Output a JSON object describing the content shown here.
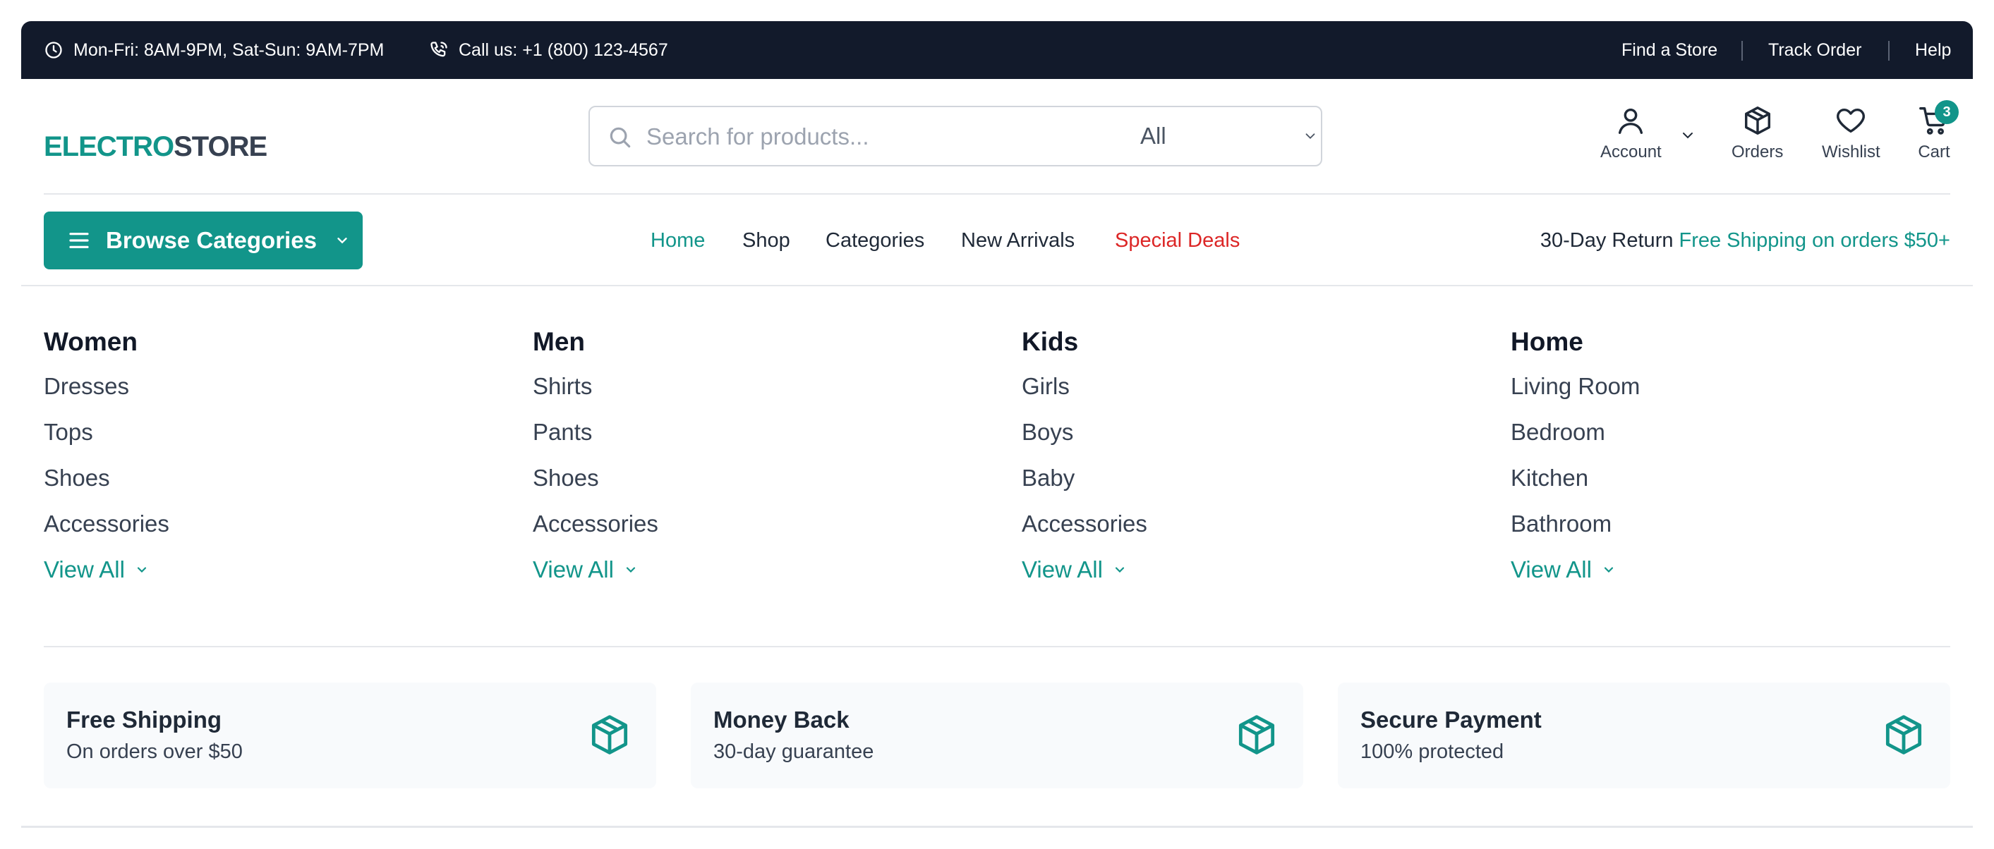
{
  "topbar": {
    "hours": "Mon-Fri: 8AM-9PM, Sat-Sun: 9AM-7PM",
    "phone": "Call us: +1 (800) 123-4567",
    "links": [
      "Find a Store",
      "Track Order",
      "Help"
    ]
  },
  "header": {
    "logo_part1": "ELECTRO",
    "logo_part2": "STORE",
    "search_placeholder": "Search for products...",
    "search_category": "All",
    "actions": {
      "account": "Account",
      "orders": "Orders",
      "wishlist": "Wishlist",
      "cart": "Cart",
      "cart_count": "3"
    }
  },
  "nav": {
    "browse_label": "Browse Categories",
    "links": [
      "Home",
      "Shop",
      "Categories",
      "New Arrivals",
      "Special Deals"
    ],
    "active": "Home",
    "highlight": "Special Deals",
    "promo_text": "30-Day Return",
    "promo_highlight": "Free Shipping on orders $50+"
  },
  "mega_menu": {
    "view_all_label": "View All",
    "columns": [
      {
        "title": "Women",
        "items": [
          "Dresses",
          "Tops",
          "Shoes",
          "Accessories"
        ]
      },
      {
        "title": "Men",
        "items": [
          "Shirts",
          "Pants",
          "Shoes",
          "Accessories"
        ]
      },
      {
        "title": "Kids",
        "items": [
          "Girls",
          "Boys",
          "Baby",
          "Accessories"
        ]
      },
      {
        "title": "Home",
        "items": [
          "Living Room",
          "Bedroom",
          "Kitchen",
          "Bathroom"
        ]
      }
    ]
  },
  "features": [
    {
      "title": "Free Shipping",
      "subtitle": "On orders over $50",
      "icon": "package-icon"
    },
    {
      "title": "Money Back",
      "subtitle": "30-day guarantee",
      "icon": "package-icon"
    },
    {
      "title": "Secure Payment",
      "subtitle": "100% protected",
      "icon": "package-icon"
    }
  ],
  "colors": {
    "accent": "#12958a",
    "topbar_bg": "#121a2b",
    "deal": "#dc2626",
    "text": "#1f2937"
  }
}
